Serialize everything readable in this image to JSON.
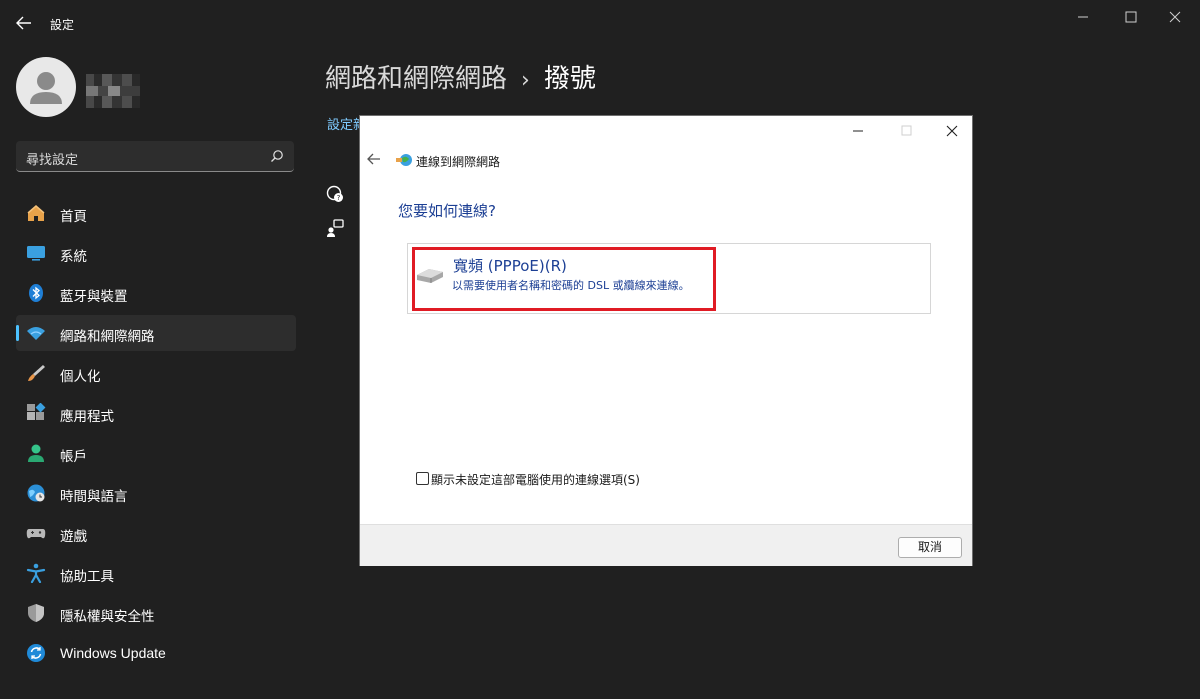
{
  "window": {
    "title": "設定",
    "controls": [
      "minimize-icon",
      "maximize-icon",
      "close-icon"
    ]
  },
  "search": {
    "placeholder": "尋找設定"
  },
  "sidebar": {
    "items": [
      {
        "label": "首頁",
        "icon": "home-icon"
      },
      {
        "label": "系統",
        "icon": "system-icon"
      },
      {
        "label": "藍牙與裝置",
        "icon": "bluetooth-icon"
      },
      {
        "label": "網路和網際網路",
        "icon": "wifi-icon",
        "active": true
      },
      {
        "label": "個人化",
        "icon": "brush-icon"
      },
      {
        "label": "應用程式",
        "icon": "apps-icon"
      },
      {
        "label": "帳戶",
        "icon": "account-icon"
      },
      {
        "label": "時間與語言",
        "icon": "time-language-icon"
      },
      {
        "label": "遊戲",
        "icon": "gamepad-icon"
      },
      {
        "label": "協助工具",
        "icon": "accessibility-icon"
      },
      {
        "label": "隱私權與安全性",
        "icon": "shield-icon"
      },
      {
        "label": "Windows Update",
        "icon": "update-icon"
      }
    ]
  },
  "main": {
    "breadcrumb_parent": "網路和網際網路",
    "breadcrumb_separator": "›",
    "breadcrumb_current": "撥號",
    "settings_link": "設定新"
  },
  "dialog": {
    "title": "連線到網際網路",
    "question": "您要如何連線?",
    "option_title": "寬頻 (PPPoE)(R)",
    "option_desc": "以需要使用者名稱和密碼的 DSL 或纜線來連線。",
    "checkbox_label": "顯示未設定這部電腦使用的連線選項(S)",
    "checkbox_checked": false,
    "cancel_label": "取消"
  },
  "colors": {
    "accent": "#4cc2ff",
    "background": "#202020",
    "link": "#1c3f94",
    "highlight": "#e01b24"
  }
}
